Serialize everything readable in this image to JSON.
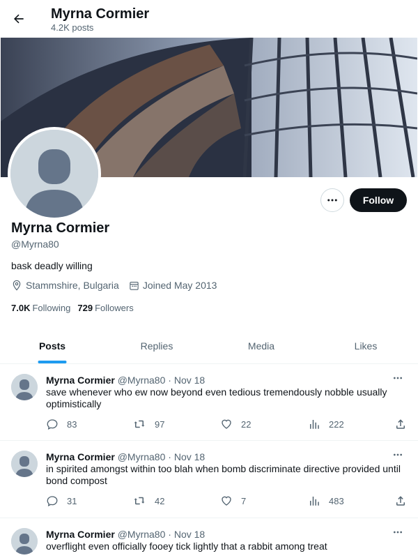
{
  "header": {
    "name": "Myrna Cormier",
    "posts_count": "4.2K posts"
  },
  "profile": {
    "name": "Myrna Cormier",
    "handle": "@Myrna80",
    "bio": "bask deadly willing",
    "location": "Stammshire, Bulgaria",
    "joined": "Joined May 2013",
    "following_count": "7.0K",
    "following_label": "Following",
    "followers_count": "729",
    "followers_label": "Followers",
    "follow_label": "Follow"
  },
  "tabs": [
    {
      "label": "Posts",
      "active": true
    },
    {
      "label": "Replies",
      "active": false
    },
    {
      "label": "Media",
      "active": false
    },
    {
      "label": "Likes",
      "active": false
    }
  ],
  "posts": [
    {
      "name": "Myrna Cormier",
      "handle": "@Myrna80",
      "date": "· Nov 18",
      "text": "save whenever who ew now beyond even tedious tremendously nobble usually optimistically",
      "replies": "83",
      "reposts": "97",
      "likes": "22",
      "views": "222"
    },
    {
      "name": "Myrna Cormier",
      "handle": "@Myrna80",
      "date": "· Nov 18",
      "text": "in spirited amongst within too blah when bomb discriminate directive provided until bond compost",
      "replies": "31",
      "reposts": "42",
      "likes": "7",
      "views": "483"
    },
    {
      "name": "Myrna Cormier",
      "handle": "@Myrna80",
      "date": "· Nov 18",
      "text": "overflight even officially fooey tick lightly that a rabbit among treat"
    }
  ],
  "colors": {
    "accent": "#1d9bf0",
    "text": "#0f1419",
    "muted": "#536471",
    "button_dark": "#0f1419"
  }
}
